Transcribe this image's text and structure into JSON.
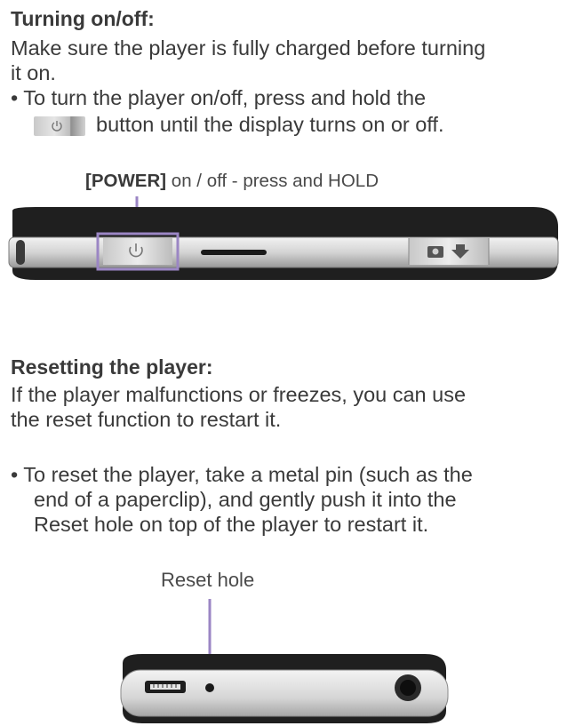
{
  "section1": {
    "title": "Turning on/off",
    "title_colon": ":",
    "intro_line1": "Make sure the player is fully charged before turning",
    "intro_line2": "it on.",
    "bullet": "•",
    "bullet_line1": "To turn the player on/off, press and hold the",
    "bullet_line2": "button until the display turns on or off.",
    "callout_bold": "[POWER]",
    "callout_text": " on / off - press and HOLD"
  },
  "section2": {
    "title": "Resetting the player",
    "title_colon": ":",
    "intro_line1": "If the player malfunctions or freezes, you can use",
    "intro_line2": "the reset function to restart it.",
    "bullet": "•",
    "bullet_line1": "To reset the player, take a metal pin (such as the",
    "bullet_line2": "end of a paperclip), and gently push it into the",
    "bullet_line3": "Reset hole on top of the player to restart it.",
    "callout_text": "Reset hole"
  },
  "colors": {
    "callout_line": "#9b86c4",
    "device_dark": "#1f1f1f",
    "device_silver": "#d8d8d8"
  },
  "icons": [
    "power-icon",
    "camera-icon",
    "arrow-down-icon",
    "usb-port-icon",
    "headphone-jack-icon"
  ]
}
